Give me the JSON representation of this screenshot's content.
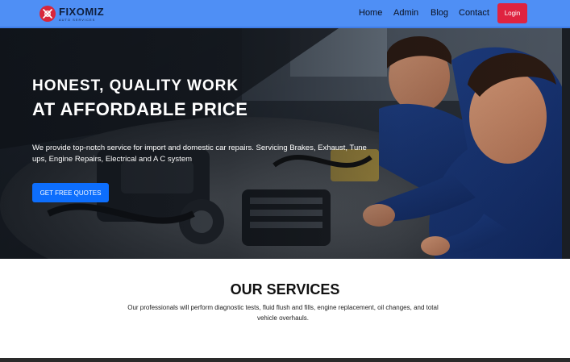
{
  "brand": {
    "name": "FIXOMIZ",
    "tagline": "auto services",
    "icon": "gear-wrench-logo-icon",
    "colors": {
      "primary": "#d9263a",
      "text": "#0f1f3d"
    }
  },
  "nav": {
    "items": [
      {
        "label": "Home"
      },
      {
        "label": "Admin"
      },
      {
        "label": "Blog"
      },
      {
        "label": "Contact"
      }
    ],
    "login_label": "Login",
    "background": "#4f8ff5",
    "login_color": "#df2340"
  },
  "hero": {
    "heading_line1": "HONEST, QUALITY WORK",
    "heading_line2": "AT AFFORDABLE PRICE",
    "description": "We provide top-notch service for import and domestic car repairs. Servicing Brakes, Exhaust, Tune ups, Engine Repairs, Electrical and A C system",
    "cta_label": "GET FREE QUOTES",
    "cta_color": "#0d6efd",
    "image": "mechanics-repairing-car-engine"
  },
  "services": {
    "title": "OUR SERVICES",
    "description": "Our professionals will perform diagnostic tests, fluid flush and fills, engine replacement, oil changes, and total vehicle overhauls."
  }
}
